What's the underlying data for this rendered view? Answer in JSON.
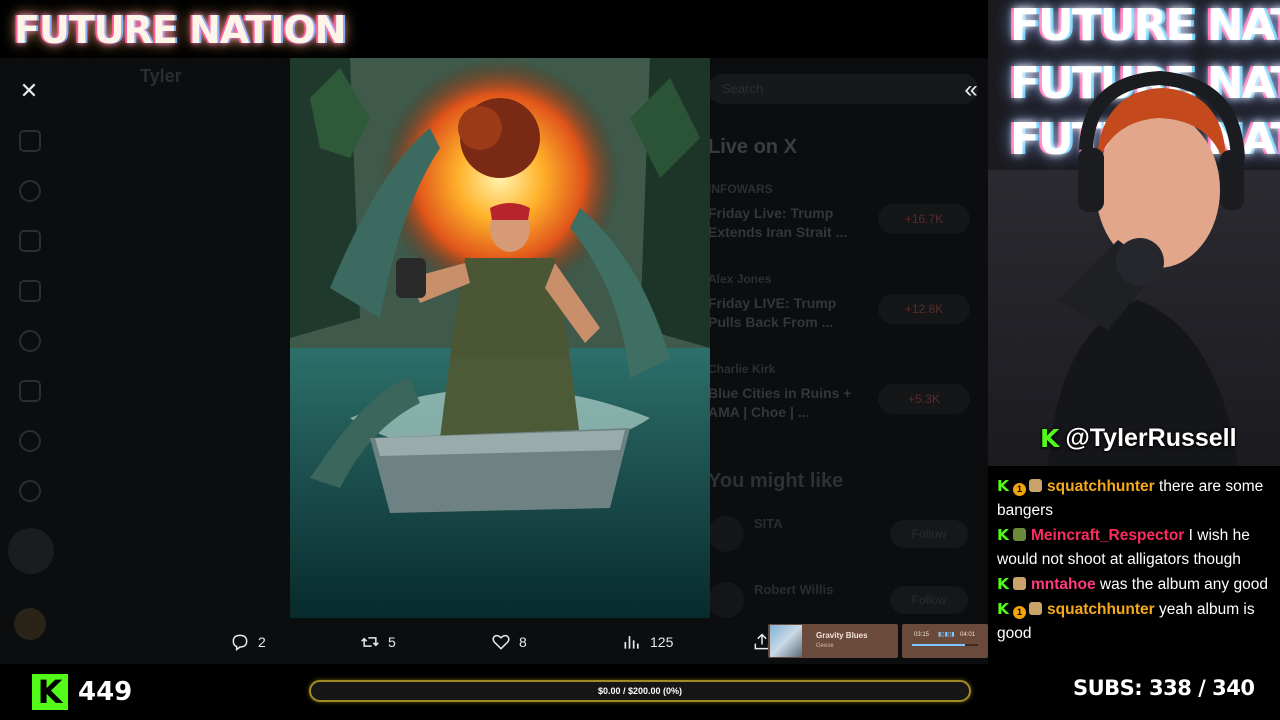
{
  "brand": {
    "title": "FUTURE NATION"
  },
  "viewer": {
    "background_header": "Tyler",
    "search_placeholder": "Search",
    "live_title": "Live on X",
    "live_items": [
      {
        "host": "INFOWARS",
        "title": "Friday Live: Trump Extends Iran Strait ...",
        "count": "+16.7K"
      },
      {
        "host": "Alex Jones",
        "title": "Friday LIVE: Trump Pulls Back From ...",
        "count": "+12.8K"
      },
      {
        "host": "Charlie Kirk",
        "title": "Blue Cities in Ruins + AMA | Choe | ...",
        "count": "+5.3K"
      }
    ],
    "might_like_title": "You might like",
    "might_like": [
      {
        "name": "SITA",
        "button": "Follow"
      },
      {
        "name": "Robert Willis",
        "button": "Follow"
      }
    ],
    "close_icon": "close-icon",
    "expand_icon": "double-chevron-left-icon",
    "actions": {
      "replies": "2",
      "reposts": "5",
      "likes": "8",
      "views": "125"
    }
  },
  "music": {
    "title": "Gravity Blues",
    "artist": "Geese",
    "elapsed": "03:15",
    "total": "04:01",
    "progress": 0.81
  },
  "cam": {
    "neon_lines": [
      "FUTURE NATION",
      "FUTURE NATION",
      "FUTURE NATION"
    ],
    "handle": "@TylerRussell"
  },
  "chat": {
    "messages": [
      {
        "user": "squatchhunter",
        "text": " there are some bangers",
        "color": "#f5a91a"
      },
      {
        "user": "Meincraft_Respector",
        "text": " I wish he would not shoot at alligators though",
        "color": "#ff2b5f"
      },
      {
        "user": "mntahoe",
        "text": " was the album any good",
        "color": "#ff3b7a"
      },
      {
        "user": "squatchhunter",
        "text": " yeah album is good",
        "color": "#f5a91a"
      }
    ]
  },
  "bottom": {
    "followers": "449",
    "goal_text": "$0.00 / $200.00 (0%)",
    "goal_progress": 0,
    "subs_label": "SUBS:",
    "subs_value": "338 / 340"
  },
  "colors": {
    "kick_green": "#53fc18",
    "goal_border": "#a08a25",
    "x_bg": "#0b0d0f"
  }
}
